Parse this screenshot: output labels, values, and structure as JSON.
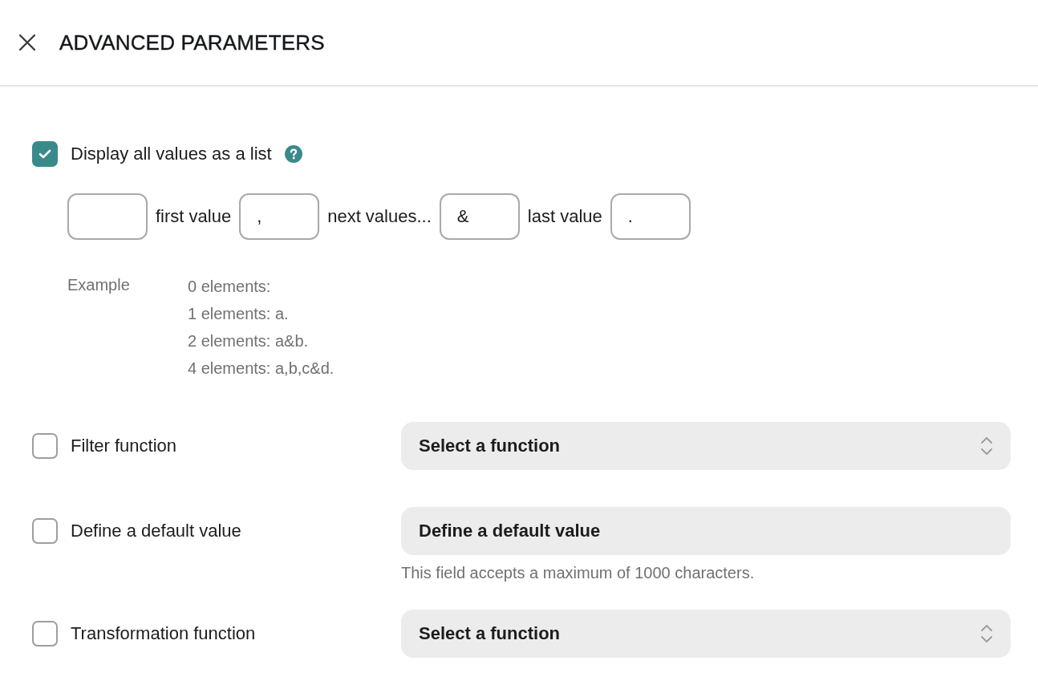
{
  "header": {
    "title": "ADVANCED PARAMETERS"
  },
  "list_option": {
    "label": "Display all values as a list",
    "checked": true,
    "separators": [
      {
        "kind": "field"
      },
      {
        "kind": "label",
        "text": "first value"
      },
      {
        "kind": "field",
        "value": ","
      },
      {
        "kind": "label",
        "text": "next values..."
      },
      {
        "kind": "field",
        "value": "&"
      },
      {
        "kind": "label",
        "text": "last value"
      },
      {
        "kind": "field",
        "value": "."
      }
    ],
    "example": {
      "label": "Example",
      "lines": [
        "0 elements:",
        "1 elements: a.",
        "2 elements: a&b.",
        "4 elements: a,b,c&d."
      ]
    }
  },
  "options": [
    {
      "kind": "select",
      "label": "Filter function",
      "checked": false,
      "placeholder": "Select a function"
    },
    {
      "kind": "input",
      "label": "Define a default value",
      "checked": false,
      "placeholder": "Define a default value",
      "hint": "This field accepts a maximum of 1000 characters."
    },
    {
      "kind": "select",
      "label": "Transformation function",
      "checked": false,
      "placeholder": "Select a function"
    }
  ]
}
